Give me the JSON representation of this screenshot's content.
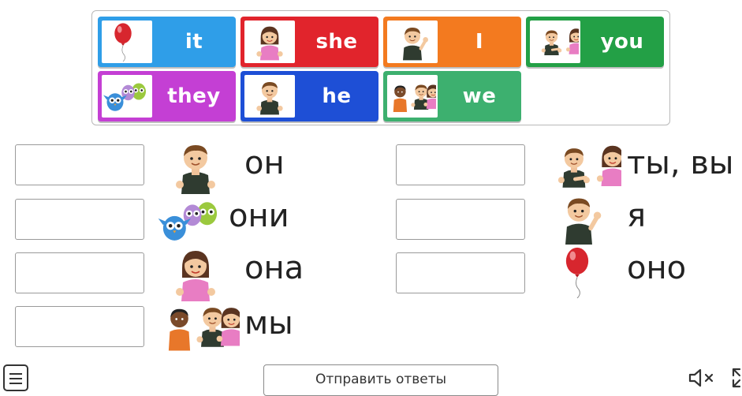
{
  "word_bank": {
    "tiles": [
      {
        "word": "it",
        "color": "#2f9ee8",
        "picture": "red-balloon"
      },
      {
        "word": "she",
        "color": "#e1242c",
        "picture": "girl"
      },
      {
        "word": "I",
        "color": "#f37a1f",
        "picture": "boy-waving"
      },
      {
        "word": "you",
        "color": "#23a046",
        "picture": "boy-pointing-girl"
      },
      {
        "word": "they",
        "color": "#c43fd4",
        "picture": "owls"
      },
      {
        "word": "he",
        "color": "#1e4fd6",
        "picture": "boy"
      },
      {
        "word": "we",
        "color": "#3db06f",
        "picture": "group-of-kids"
      }
    ]
  },
  "targets": [
    {
      "label": "он",
      "picture": "boy"
    },
    {
      "label": "они",
      "picture": "owls"
    },
    {
      "label": "она",
      "picture": "girl"
    },
    {
      "label": "мы",
      "picture": "group-of-kids"
    },
    {
      "label": "ты, вы",
      "picture": "boy-pointing-girl"
    },
    {
      "label": "я",
      "picture": "boy-waving"
    },
    {
      "label": "оно",
      "picture": "red-balloon"
    }
  ],
  "footer": {
    "submit_label": "Отправить ответы",
    "menu_icon": "menu-icon",
    "mute_icon": "speaker-muted-icon",
    "fullscreen_icon": "fullscreen-icon"
  }
}
